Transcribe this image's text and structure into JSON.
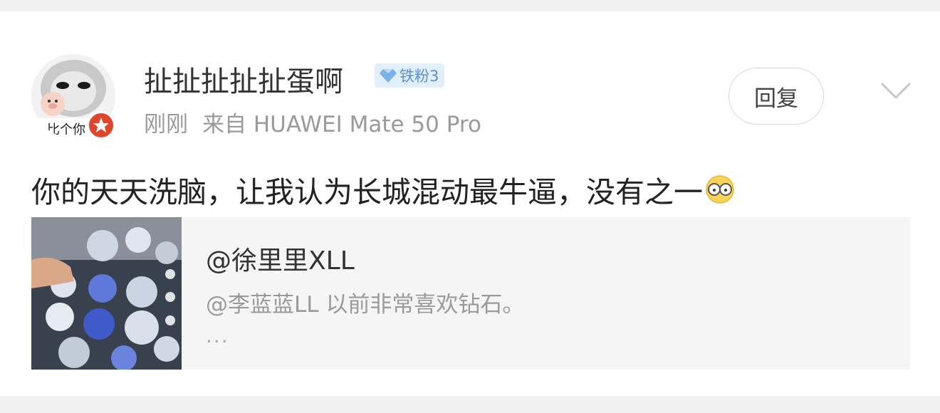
{
  "comment": {
    "username": "扯扯扯扯扯蛋啊",
    "fan_badge": {
      "label": "铁粉3",
      "icon": "diamond-icon",
      "color": "#5b8fc8"
    },
    "time": "刚刚",
    "source": "来自 HUAWEI Mate 50 Pro",
    "reply_label": "回复",
    "text": "你的天天洗脑，让我认为长城混动最牛逼，没有之一",
    "emoji": "glasses-emoji-icon",
    "avatar_caption": "比个你",
    "accent_color": "#e0452b"
  },
  "quote": {
    "title": "@徐里里XLL",
    "text": "@李蓝蓝LL 以前非常喜欢钻石。",
    "ellipsis": "..."
  }
}
